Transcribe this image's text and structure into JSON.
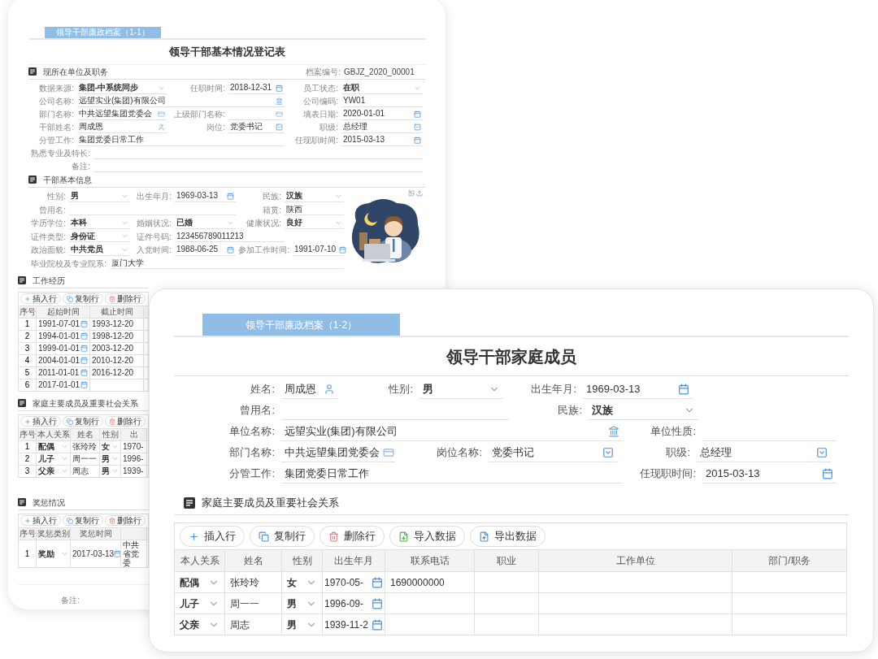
{
  "back_card": {
    "tab": {
      "label": "领导干部廉政档案（1-1）",
      "selected": true
    },
    "title": "领导干部基本情况登记表",
    "unit_section": {
      "title": "现所在单位及职务",
      "archive_no": {
        "label": "档案编号:",
        "value": "GBJZ_2020_00001"
      },
      "rows": [
        [
          {
            "label": "数据来源:",
            "value": "集团-中系统同步",
            "kind": "select"
          },
          {
            "label": "任职时间:",
            "value": "2018-12-31",
            "kind": "date"
          },
          {
            "label": "员工状态:",
            "value": "在职",
            "kind": "select"
          }
        ],
        [
          {
            "label": "公司名称:",
            "value": "远望实业(集团)有限公司",
            "kind": "building"
          },
          {
            "label": "公司编码:",
            "value": "YW01",
            "kind": "text"
          }
        ],
        [
          {
            "label": "部门名称:",
            "value": "中共远望集团党委会",
            "kind": "dept"
          },
          {
            "label": "上级部门名称:",
            "kind": "dept"
          },
          {
            "label": "填表日期:",
            "value": "2020-01-01",
            "kind": "date"
          }
        ],
        [
          {
            "label": "干部姓名:",
            "value": "周成恩",
            "kind": "person"
          },
          {
            "label": "岗位:",
            "value": "党委书记",
            "kind": "post"
          },
          {
            "label": "职级:",
            "value": "总经理",
            "kind": "post"
          }
        ],
        [
          {
            "label": "分管工作:",
            "value": "集团党委日常工作",
            "kind": "text"
          },
          {
            "label": "任现职时间:",
            "value": "2015-03-13",
            "kind": "date"
          }
        ],
        [
          {
            "label": "熟悉专业及特长:",
            "kind": "text"
          }
        ],
        [
          {
            "label": "备注:",
            "kind": "text"
          }
        ]
      ]
    },
    "basic_section": {
      "title": "干部基本信息",
      "photo": {
        "kind": "picture"
      },
      "rows": [
        [
          {
            "label": "性别:",
            "value": "男",
            "kind": "select"
          },
          {
            "label": "出生年月:",
            "value": "1969-03-13",
            "kind": "date"
          },
          {
            "label": "民族:",
            "value": "汉族",
            "kind": "select"
          }
        ],
        [
          {
            "label": "曾用名:",
            "kind": "text"
          },
          {
            "kind": "blank"
          },
          {
            "label": "籍贯:",
            "value": "陕西",
            "kind": "text"
          }
        ],
        [
          {
            "label": "学历学位:",
            "value": "本科",
            "kind": "select"
          },
          {
            "label": "婚姻状况:",
            "value": "已婚",
            "kind": "select"
          },
          {
            "label": "健康状况:",
            "value": "良好",
            "kind": "select"
          }
        ],
        [
          {
            "label": "证件类型:",
            "value": "身份证",
            "kind": "select"
          },
          {
            "label": "证件号码:",
            "value": "123456789011213",
            "kind": "text"
          }
        ],
        [
          {
            "label": "政治面貌:",
            "value": "中共党员",
            "kind": "select"
          },
          {
            "label": "入党时间:",
            "value": "1988-06-25",
            "kind": "date"
          },
          {
            "label": "参加工作时间:",
            "value": "1991-07-10",
            "kind": "date"
          }
        ],
        [
          {
            "label": "毕业院校及专业院系:",
            "value": "厦门大学",
            "kind": "text"
          }
        ]
      ]
    },
    "tables": [
      {
        "title": "工作经历",
        "toolbar": [
          {
            "label": "插入行",
            "kind": "insert"
          },
          {
            "label": "复制行",
            "kind": "copy"
          },
          {
            "label": "删除行",
            "kind": "delete"
          }
        ],
        "columns": [
          {
            "label": "序号",
            "kind": "index"
          },
          {
            "label": "起始时间",
            "kind": "date"
          },
          {
            "label": "截止时间",
            "kind": "text"
          }
        ],
        "rows": [
          [
            "1",
            "1991-07-01",
            "1993-12-20"
          ],
          [
            "2",
            "1994-01-01",
            "1998-12-20"
          ],
          [
            "3",
            "1999-01-01",
            "2003-12-20"
          ],
          [
            "4",
            "2004-01-01",
            "2010-12-20"
          ],
          [
            "5",
            "2011-01-01",
            "2016-12-20"
          ],
          [
            "6",
            "2017-01-01"
          ]
        ]
      },
      {
        "title": "家庭主要成员及重要社会关系",
        "toolbar": [
          {
            "label": "插入行",
            "kind": "insert"
          },
          {
            "label": "复制行",
            "kind": "copy"
          },
          {
            "label": "删除行",
            "kind": "delete"
          }
        ],
        "columns": [
          {
            "label": "序号",
            "kind": "index"
          },
          {
            "label": "本人关系",
            "kind": "select"
          },
          {
            "label": "姓名",
            "kind": "text"
          },
          {
            "label": "性别",
            "kind": "select"
          },
          {
            "label": "出",
            "kind": "text"
          }
        ],
        "rows": [
          [
            "1",
            "配偶",
            "张玲玲",
            "女",
            "1970-"
          ],
          [
            "2",
            "儿子",
            "周一一",
            "男",
            "1996-"
          ],
          [
            "3",
            "父亲",
            "周志",
            "男",
            "1939-"
          ]
        ]
      },
      {
        "title": "奖惩情况",
        "toolbar": [
          {
            "label": "插入行",
            "kind": "insert"
          },
          {
            "label": "复制行",
            "kind": "copy"
          },
          {
            "label": "删除行",
            "kind": "delete"
          }
        ],
        "columns": [
          {
            "label": "序号",
            "kind": "index"
          },
          {
            "label": "奖惩类别",
            "kind": "select"
          },
          {
            "label": "奖惩时间",
            "kind": "date"
          },
          {
            "kind": "text"
          }
        ],
        "rows": [
          [
            "1",
            "奖励",
            "2017-03-13",
            "中共省党委"
          ]
        ]
      }
    ],
    "remark": {
      "label": "备注:"
    }
  },
  "front_card": {
    "tab": {
      "label": "领导干部廉政档案（1-2）",
      "selected": true
    },
    "title": "领导干部家庭成员",
    "rows": [
      [
        {
          "label": "姓名:",
          "value": "周成恩",
          "kind": "person"
        },
        {
          "label": "性别:",
          "value": "男",
          "kind": "select"
        },
        {
          "label": "出生年月:",
          "value": "1969-03-13",
          "kind": "date"
        }
      ],
      [
        {
          "label": "曾用名:",
          "kind": "text"
        },
        {
          "label": "民族:",
          "value": "汉族",
          "kind": "select"
        }
      ],
      [
        {
          "label": "单位名称:",
          "value": "远望实业(集团)有限公司",
          "kind": "building"
        },
        {
          "label": "单位性质:",
          "kind": "text"
        }
      ],
      [
        {
          "label": "部门名称:",
          "value": "中共远望集团党委会",
          "kind": "dept"
        },
        {
          "label": "岗位名称:",
          "value": "党委书记",
          "kind": "post"
        },
        {
          "label": "职级:",
          "value": "总经理",
          "kind": "post"
        }
      ],
      [
        {
          "label": "分管工作:",
          "value": "集团党委日常工作",
          "kind": "text"
        },
        {
          "label": "任现职时间:",
          "value": "2015-03-13",
          "kind": "date"
        }
      ]
    ],
    "table": {
      "title": "家庭主要成员及重要社会关系",
      "toolbar": [
        {
          "label": "插入行",
          "kind": "insert"
        },
        {
          "label": "复制行",
          "kind": "copy"
        },
        {
          "label": "删除行",
          "kind": "delete"
        },
        {
          "label": "导入数据",
          "kind": "import"
        },
        {
          "label": "导出数据",
          "kind": "export"
        }
      ],
      "columns": [
        {
          "label": "本人关系",
          "kind": "select"
        },
        {
          "label": "姓名",
          "kind": "text"
        },
        {
          "label": "性别",
          "kind": "select"
        },
        {
          "label": "出生年月",
          "kind": "date"
        },
        {
          "label": "联系电话",
          "kind": "text"
        },
        {
          "label": "职业",
          "kind": "text"
        },
        {
          "label": "工作单位",
          "kind": "text"
        },
        {
          "label": "部门/职务",
          "kind": "text"
        }
      ],
      "rows": [
        [
          "配偶",
          "张玲玲",
          "女",
          "1970-05-",
          "1690000000"
        ],
        [
          "儿子",
          "周一一",
          "男",
          "1996-09-"
        ],
        [
          "父亲",
          "周志",
          "男",
          "1939-11-2"
        ]
      ]
    }
  }
}
